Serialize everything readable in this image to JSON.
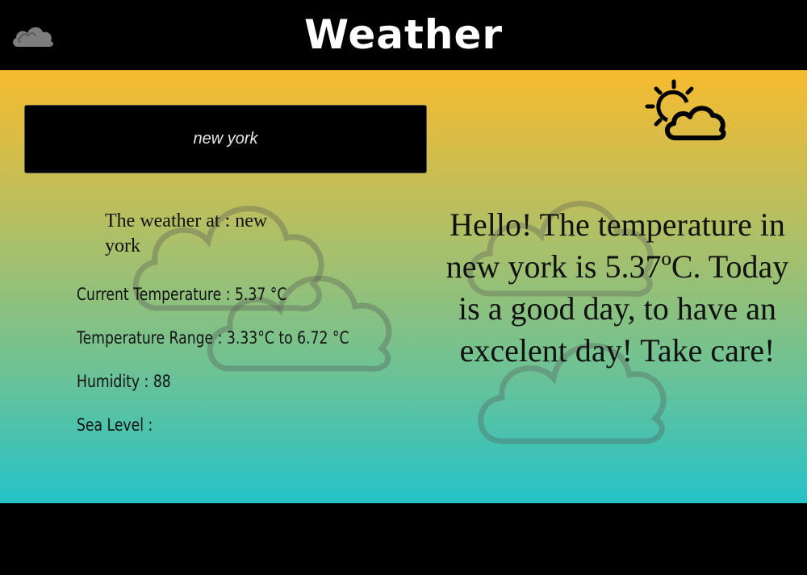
{
  "header": {
    "title": "Weather",
    "logo_icon": "cloud-icon"
  },
  "search": {
    "value": "new york"
  },
  "weather_icon": "partly-sunny-icon",
  "location": {
    "text": "The weather at : new york"
  },
  "stats": {
    "current_temperature": "Current Temperature : 5.37 °C",
    "temperature_range": "Temperature Range : 3.33°C to 6.72 °C",
    "humidity": "Humidity : 88",
    "sea_level": "Sea Level :"
  },
  "message": {
    "text": "Hello! The temperature in new york is 5.37ºC. Today is a good day, to have an excelent day! Take care!"
  },
  "colors": {
    "gradient_top": "#f7bb2f",
    "gradient_bottom": "#24c3c8",
    "bar": "#000000"
  }
}
